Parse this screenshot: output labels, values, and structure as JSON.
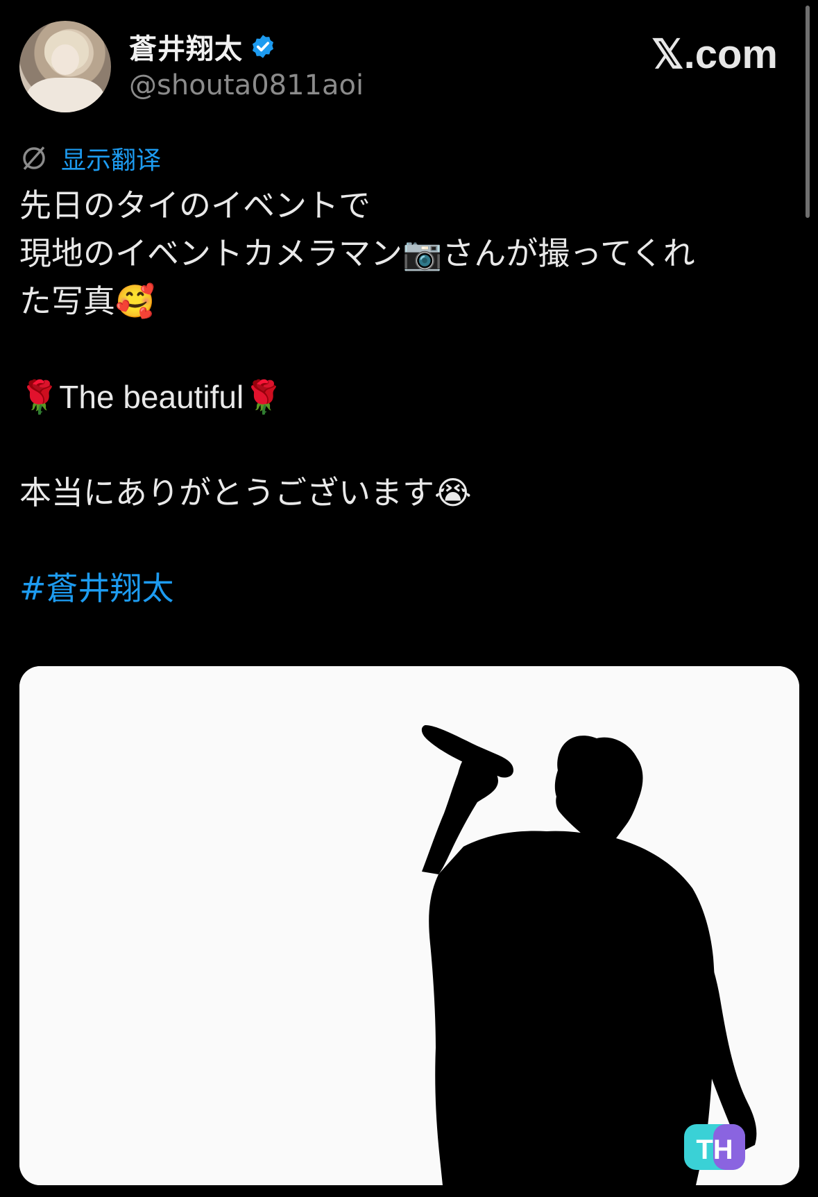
{
  "author": {
    "display_name": "蒼井翔太",
    "handle": "@shouta0811aoi",
    "verified": true,
    "avatar_icon": "profile-avatar"
  },
  "brand": "𝕏.com",
  "translate_label": "显示翻译",
  "tweet": {
    "line1": "先日のタイのイベントで",
    "line2": "現地のイベントカメラマン📷さんが撮ってくれ",
    "line3": "た写真🥰",
    "line4": "🌹The beautiful🌹",
    "line5": "本当にありがとうございます😭",
    "hashtag": "#蒼井翔太"
  },
  "colors": {
    "accent": "#1d9bf0",
    "background": "#000000",
    "text": "#e7e9ea",
    "muted": "#8b8b8b"
  },
  "media": {
    "description_icon": "singer-silhouette-photo",
    "watermark": "TH"
  }
}
